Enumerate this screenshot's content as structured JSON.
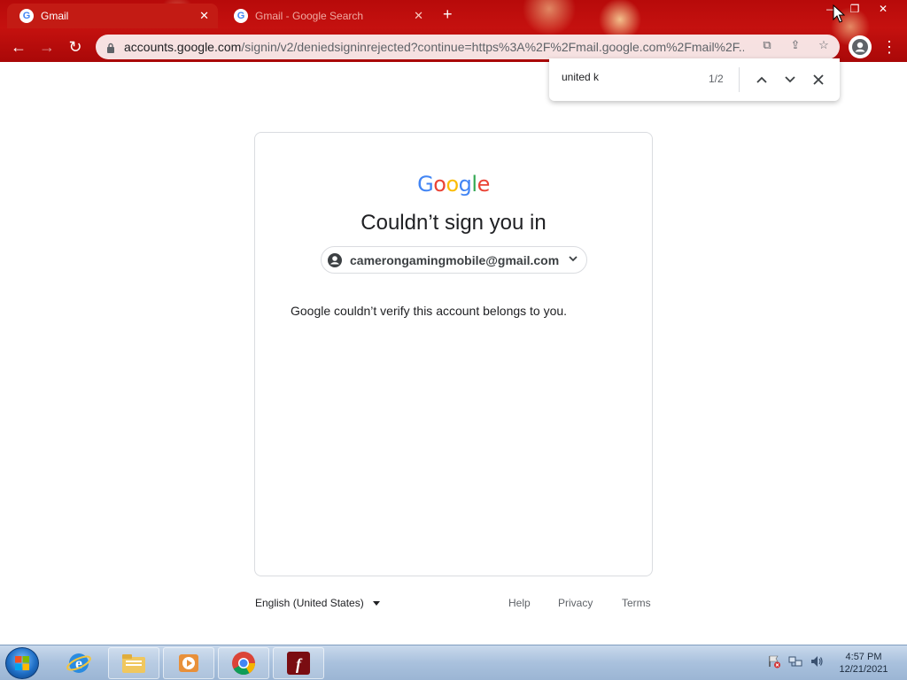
{
  "browser": {
    "tabs": [
      {
        "label": "Gmail",
        "active": true
      },
      {
        "label": "Gmail - Google Search",
        "active": false
      }
    ],
    "url_host": "accounts.google.com",
    "url_path": "/signin/v2/deniedsigninrejected?continue=https%3A%2F%2Fmail.google.com%2Fmail%2F..."
  },
  "find_bar": {
    "query": "united k",
    "count": "1/2"
  },
  "signin": {
    "logo_letters": [
      {
        "ch": "G",
        "color": "#4285F4"
      },
      {
        "ch": "o",
        "color": "#EA4335"
      },
      {
        "ch": "o",
        "color": "#FBBC05"
      },
      {
        "ch": "g",
        "color": "#4285F4"
      },
      {
        "ch": "l",
        "color": "#34A853"
      },
      {
        "ch": "e",
        "color": "#EA4335"
      }
    ],
    "heading": "Couldn’t sign you in",
    "account_email": "camerongamingmobile@gmail.com",
    "message": "Google couldn’t verify this account belongs to you."
  },
  "footer": {
    "language": "English (United States)",
    "links": [
      "Help",
      "Privacy",
      "Terms"
    ]
  },
  "taskbar": {
    "time": "4:57 PM",
    "date": "12/21/2021"
  },
  "colors": {
    "chrome_red": "#c31b14",
    "google_blue": "#4285F4",
    "taskbar": "#a9c1dd"
  }
}
